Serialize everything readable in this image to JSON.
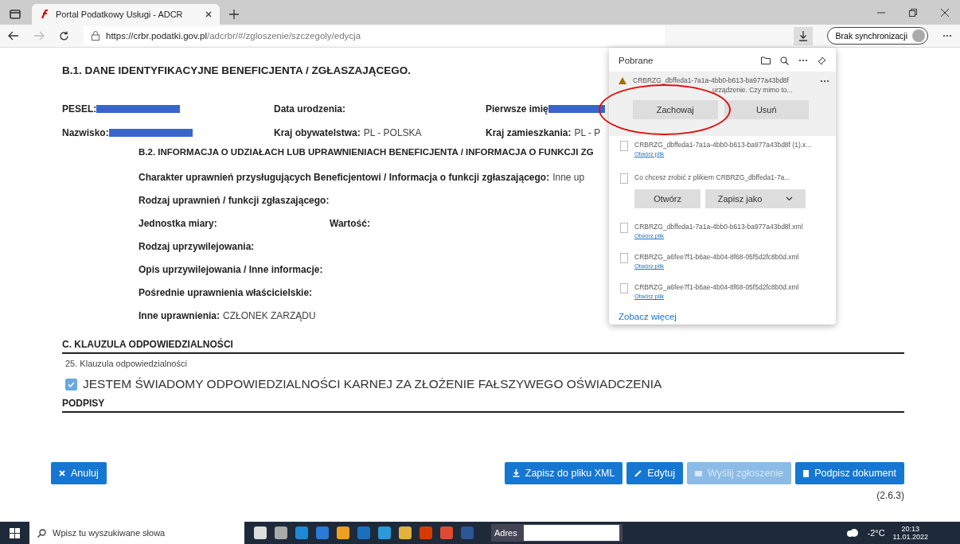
{
  "browser": {
    "tab": {
      "title": "Portal Podatkowy Usługi - ADCR",
      "selected": true
    },
    "url": {
      "host": "https://crbr.podatki.gov.pl",
      "path": "/adcrbr/#/zgloszenie/szczegoly/edycja"
    },
    "sync_button": "Brak synchronizacji"
  },
  "section_b1": {
    "heading": "B.1. DANE IDENTYFIKACYJNE BENEFICJENTA / ZGŁASZAJĄCEGO.",
    "rows": [
      [
        {
          "label": "PESEL:",
          "redacted": true
        },
        {
          "label": "Data urodzenia:"
        },
        {
          "label": "Pierwsze imię",
          "redacted": true
        }
      ],
      [
        {
          "label": "Nazwisko:",
          "redacted": true
        },
        {
          "label": "Kraj obywatelstwa:",
          "value": "PL - POLSKA"
        },
        {
          "label": "Kraj zamieszkania:",
          "value": "PL - P"
        }
      ]
    ]
  },
  "section_b2": {
    "heading": "B.2. INFORMACJA O UDZIAŁACH LUB UPRAWNIENIACH BENEFICJENTA / INFORMACJA O FUNKCJI ZG",
    "rows": [
      [
        {
          "label": "Charakter uprawnień przysługujących Beneficjentowi / Informacja o funkcji zgłaszającego:",
          "value": "Inne up"
        }
      ],
      [
        {
          "label": "Rodzaj uprawnień / funkcji zgłaszającego:"
        }
      ],
      [
        {
          "label": "Jednostka miary:"
        },
        {
          "label": "Wartość:"
        }
      ],
      [
        {
          "label": "Rodzaj uprzywilejowania:"
        }
      ],
      [
        {
          "label": "Opis uprzywilejowania / Inne informacje:"
        }
      ],
      [
        {
          "label": "Pośrednie uprawnienia właścicielskie:"
        }
      ],
      [
        {
          "label": "Inne uprawnienia:",
          "value": "CZŁONEK ZARZĄDU"
        }
      ]
    ]
  },
  "section_c": {
    "heading": "C. KLAUZULA ODPOWIEDZIALNOŚCI",
    "field_label": "25. Klauzula odpowiedzialności",
    "checkbox": {
      "label": "JESTEM ŚWIADOMY ODPOWIEDZIALNOŚCI KARNEJ ZA ZŁOŻENIE FAŁSZYWEGO OŚWIADCZENIA",
      "checked": true
    }
  },
  "signatures": {
    "heading": "PODPISY"
  },
  "actions": [
    {
      "kind": "cancel",
      "label": "Anuluj",
      "disabled": false
    },
    {
      "kind": "save",
      "label": "Zapisz do pliku XML",
      "disabled": false
    },
    {
      "kind": "edit",
      "label": "Edytuj",
      "disabled": false
    },
    {
      "kind": "send",
      "label": "Wyślij zgłoszenie",
      "disabled": true
    },
    {
      "kind": "sign",
      "label": "Podpisz dokument",
      "disabled": false
    }
  ],
  "version": "(2.6.3)",
  "downloads": {
    "title": "Pobrane",
    "items": [
      {
        "kind": "warning",
        "name": "CRBRZG_dbffeda1-7a1a-4bb0-b613-ba977a43bd8f",
        "message": "urządzenie. Czy mimo to...",
        "buttons": [
          "Zachowaj",
          "Usuń"
        ]
      },
      {
        "kind": "file",
        "name": "CRBRZG_dbffeda1-7a1a-4bb0-b613-ba977a43bd8f (1).x...",
        "link": "Otwórz plik"
      },
      {
        "kind": "prompt",
        "name": "Co chcesz zrobić z plikiem CRBRZG_dbffeda1-7a...",
        "buttons": [
          "Otwórz",
          "Zapisz jako"
        ]
      },
      {
        "kind": "file",
        "name": "CRBRZG_dbffeda1-7a1a-4bb0-b613-ba977a43bd8f.xml",
        "link": "Otwórz plik"
      },
      {
        "kind": "file",
        "name": "CRBRZG_a6fee7f1-b6ae-4b04-8f68-05f5d2fc8b0d.xml",
        "link": "Otwórz plik"
      },
      {
        "kind": "file",
        "name": "CRBRZG_a6fee7f1-b6ae-4b04-8f68-05f5d2fc8b0d.xml",
        "link": "Otwórz plik"
      }
    ],
    "more_link": "Zobacz więcej"
  },
  "taskbar": {
    "search_placeholder": "Wpisz tu wyszukiwane słowa",
    "address_label": "Adres",
    "temperature": "-2°C",
    "time": "20:13",
    "date": "11.01.2022"
  }
}
